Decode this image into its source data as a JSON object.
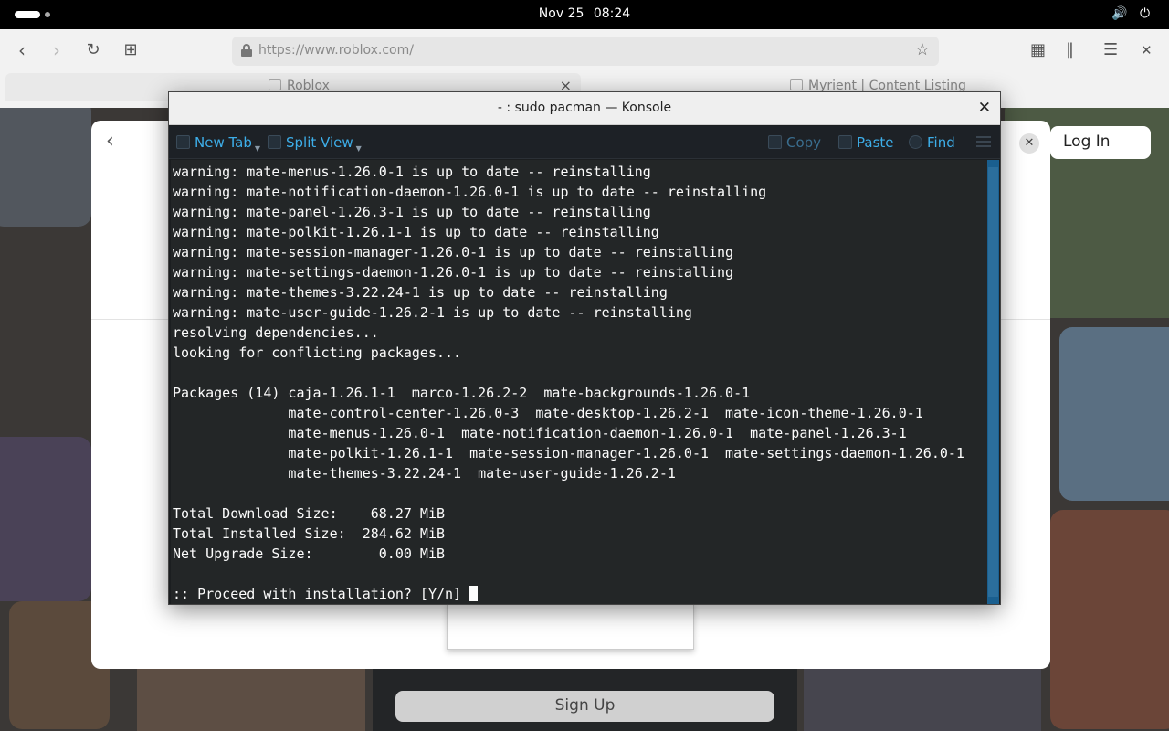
{
  "topbar": {
    "date": "Nov 25",
    "time": "08:24",
    "volume_icon": "speaker-icon",
    "power_icon": "power-icon"
  },
  "browser": {
    "url": "https://www.roblox.com/",
    "tabs": [
      {
        "title": "Roblox",
        "active": true
      },
      {
        "title": "Myrient | Content Listing",
        "active": false
      }
    ]
  },
  "page": {
    "login_label": "Log In",
    "signup_label": "Sign Up"
  },
  "konsole": {
    "title": "- : sudo pacman — Konsole",
    "toolbar": {
      "new_tab": "New Tab",
      "split_view": "Split View",
      "copy": "Copy",
      "paste": "Paste",
      "find": "Find"
    },
    "lines": [
      "warning: mate-menus-1.26.0-1 is up to date -- reinstalling",
      "warning: mate-notification-daemon-1.26.0-1 is up to date -- reinstalling",
      "warning: mate-panel-1.26.3-1 is up to date -- reinstalling",
      "warning: mate-polkit-1.26.1-1 is up to date -- reinstalling",
      "warning: mate-session-manager-1.26.0-1 is up to date -- reinstalling",
      "warning: mate-settings-daemon-1.26.0-1 is up to date -- reinstalling",
      "warning: mate-themes-3.22.24-1 is up to date -- reinstalling",
      "warning: mate-user-guide-1.26.2-1 is up to date -- reinstalling",
      "resolving dependencies...",
      "looking for conflicting packages...",
      "",
      "Packages (14) caja-1.26.1-1  marco-1.26.2-2  mate-backgrounds-1.26.0-1",
      "              mate-control-center-1.26.0-3  mate-desktop-1.26.2-1  mate-icon-theme-1.26.0-1",
      "              mate-menus-1.26.0-1  mate-notification-daemon-1.26.0-1  mate-panel-1.26.3-1",
      "              mate-polkit-1.26.1-1  mate-session-manager-1.26.0-1  mate-settings-daemon-1.26.0-1",
      "              mate-themes-3.22.24-1  mate-user-guide-1.26.2-1",
      "",
      "Total Download Size:    68.27 MiB",
      "Total Installed Size:  284.62 MiB",
      "Net Upgrade Size:        0.00 MiB",
      ""
    ],
    "prompt": ":: Proceed with installation? [Y/n] "
  }
}
